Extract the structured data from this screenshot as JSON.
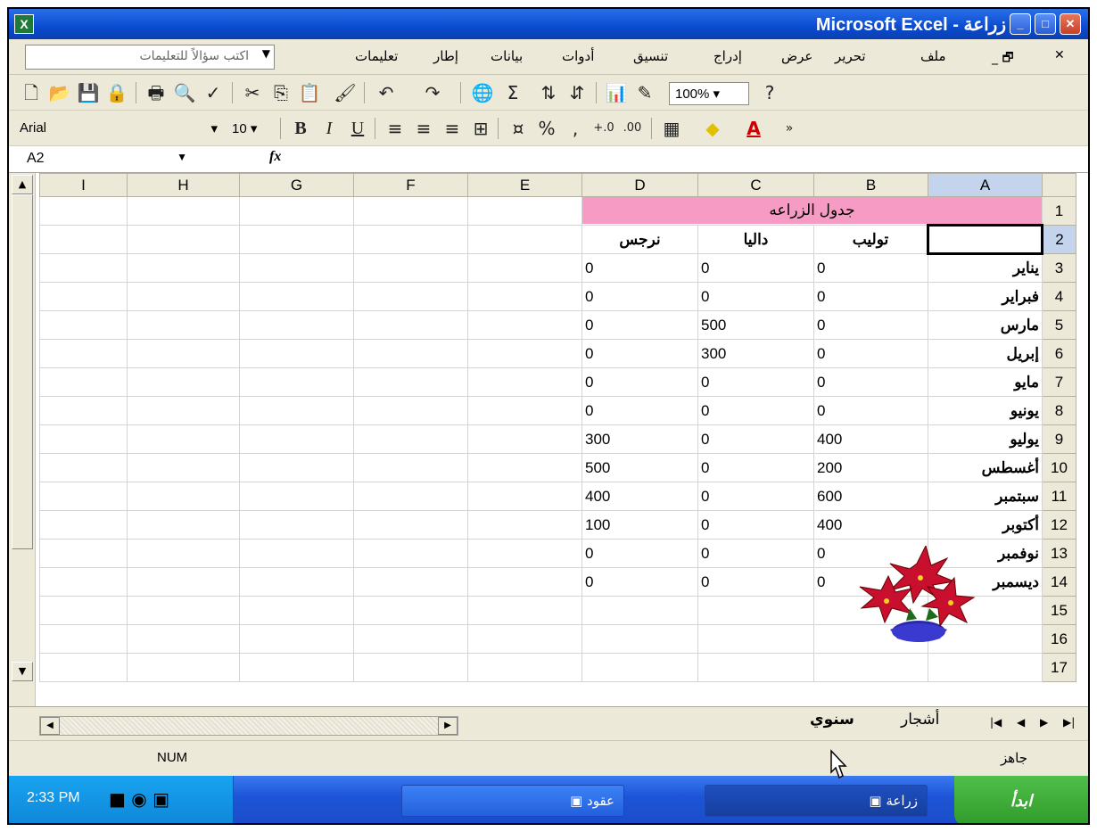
{
  "window": {
    "title": "Microsoft Excel - زراعة"
  },
  "menu": {
    "items": [
      "ملف",
      "تحرير",
      "عرض",
      "إدراج",
      "تنسيق",
      "أدوات",
      "بيانات",
      "إطار",
      "تعليمات"
    ],
    "ask_placeholder": "اكتب سؤالاً للتعليمات"
  },
  "toolbar": {
    "zoom": "100%",
    "font": "Arial",
    "font_size": "10"
  },
  "formula": {
    "name_box": "A2",
    "fx": "fx"
  },
  "columns": [
    "I",
    "H",
    "G",
    "F",
    "E",
    "D",
    "C",
    "B",
    "A"
  ],
  "sheet": {
    "title": "جدول الزراعه",
    "headers": {
      "B": "توليب",
      "C": "داليا",
      "D": "نرجس"
    },
    "rows": [
      {
        "n": "3",
        "month": "يناير",
        "B": "0",
        "C": "0",
        "D": "0"
      },
      {
        "n": "4",
        "month": "فبراير",
        "B": "0",
        "C": "0",
        "D": "0"
      },
      {
        "n": "5",
        "month": "مارس",
        "B": "0",
        "C": "500",
        "D": "0"
      },
      {
        "n": "6",
        "month": "إبريل",
        "B": "0",
        "C": "300",
        "D": "0"
      },
      {
        "n": "7",
        "month": "مايو",
        "B": "0",
        "C": "0",
        "D": "0"
      },
      {
        "n": "8",
        "month": "يونيو",
        "B": "0",
        "C": "0",
        "D": "0"
      },
      {
        "n": "9",
        "month": "يوليو",
        "B": "400",
        "C": "0",
        "D": "300"
      },
      {
        "n": "10",
        "month": "أغسطس",
        "B": "200",
        "C": "0",
        "D": "500"
      },
      {
        "n": "11",
        "month": "سبتمبر",
        "B": "600",
        "C": "0",
        "D": "400"
      },
      {
        "n": "12",
        "month": "أكتوبر",
        "B": "400",
        "C": "0",
        "D": "100"
      },
      {
        "n": "13",
        "month": "نوفمبر",
        "B": "0",
        "C": "0",
        "D": "0"
      },
      {
        "n": "14",
        "month": "ديسمبر",
        "B": "0",
        "C": "0",
        "D": "0"
      }
    ],
    "empty_rows": [
      "15",
      "16",
      "17"
    ],
    "row1": "1",
    "row2": "2"
  },
  "tabs": [
    "سنوي",
    "أشجار"
  ],
  "status": {
    "ready": "جاهز",
    "num": "NUM"
  },
  "taskbar": {
    "clock": "2:33 PM",
    "items": [
      "زراعة",
      "عقود"
    ],
    "start": "ابدأ"
  }
}
